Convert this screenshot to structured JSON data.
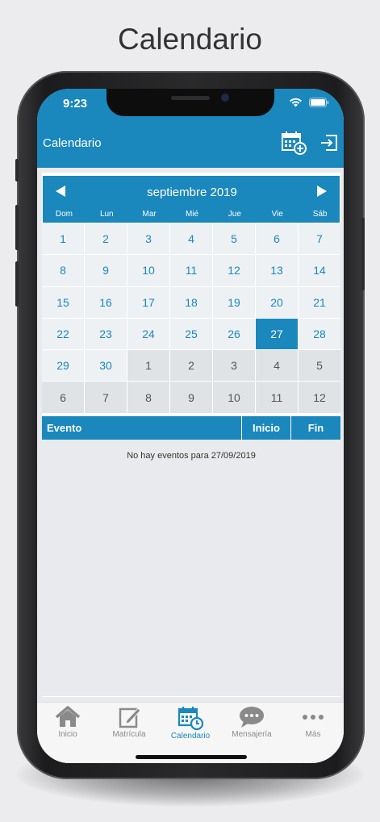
{
  "page_title": "Calendario",
  "status": {
    "time": "9:23"
  },
  "header": {
    "title": "Calendario",
    "add_icon": "calendar-add-icon",
    "exit_icon": "exit-icon"
  },
  "calendar": {
    "month_label": "septiembre 2019",
    "weekdays": [
      "Dom",
      "Lun",
      "Mar",
      "Mié",
      "Jue",
      "Vie",
      "Sáb"
    ],
    "days": [
      {
        "n": "1",
        "m": true
      },
      {
        "n": "2",
        "m": true
      },
      {
        "n": "3",
        "m": true
      },
      {
        "n": "4",
        "m": true
      },
      {
        "n": "5",
        "m": true
      },
      {
        "n": "6",
        "m": true
      },
      {
        "n": "7",
        "m": true
      },
      {
        "n": "8",
        "m": true
      },
      {
        "n": "9",
        "m": true
      },
      {
        "n": "10",
        "m": true
      },
      {
        "n": "11",
        "m": true
      },
      {
        "n": "12",
        "m": true
      },
      {
        "n": "13",
        "m": true
      },
      {
        "n": "14",
        "m": true
      },
      {
        "n": "15",
        "m": true
      },
      {
        "n": "16",
        "m": true
      },
      {
        "n": "17",
        "m": true
      },
      {
        "n": "18",
        "m": true
      },
      {
        "n": "19",
        "m": true
      },
      {
        "n": "20",
        "m": true
      },
      {
        "n": "21",
        "m": true
      },
      {
        "n": "22",
        "m": true
      },
      {
        "n": "23",
        "m": true
      },
      {
        "n": "24",
        "m": true
      },
      {
        "n": "25",
        "m": true
      },
      {
        "n": "26",
        "m": true
      },
      {
        "n": "27",
        "m": true,
        "selected": true
      },
      {
        "n": "28",
        "m": true
      },
      {
        "n": "29",
        "m": true
      },
      {
        "n": "30",
        "m": true
      },
      {
        "n": "1",
        "m": false
      },
      {
        "n": "2",
        "m": false
      },
      {
        "n": "3",
        "m": false
      },
      {
        "n": "4",
        "m": false
      },
      {
        "n": "5",
        "m": false
      },
      {
        "n": "6",
        "m": false
      },
      {
        "n": "7",
        "m": false
      },
      {
        "n": "8",
        "m": false
      },
      {
        "n": "9",
        "m": false
      },
      {
        "n": "10",
        "m": false
      },
      {
        "n": "11",
        "m": false
      },
      {
        "n": "12",
        "m": false
      }
    ]
  },
  "events": {
    "columns": {
      "event": "Evento",
      "start": "Inicio",
      "end": "Fin"
    },
    "empty_message": "No hay eventos para 27/09/2019"
  },
  "tabs": [
    {
      "label": "Inicio",
      "icon": "home-icon",
      "active": false
    },
    {
      "label": "Matrícula",
      "icon": "edit-icon",
      "active": false
    },
    {
      "label": "Calendario",
      "icon": "calendar-clock-icon",
      "active": true
    },
    {
      "label": "Mensajería",
      "icon": "chat-icon",
      "active": false
    },
    {
      "label": "Más",
      "icon": "more-icon",
      "active": false
    }
  ],
  "colors": {
    "accent": "#1a87bd",
    "background": "#e8eaed"
  }
}
